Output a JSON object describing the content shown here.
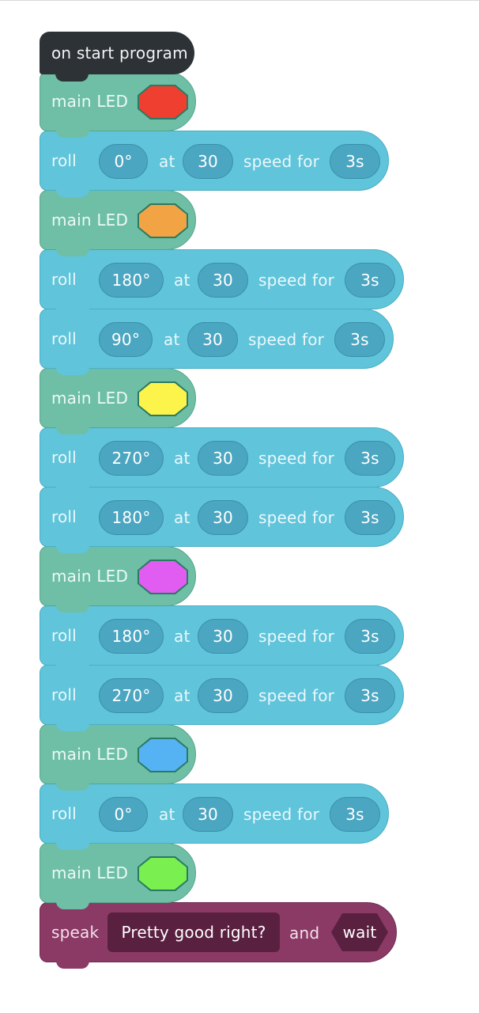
{
  "start": {
    "label": "on start program"
  },
  "blocks": [
    {
      "type": "led",
      "label": "main LED",
      "color": "#ee3f30"
    },
    {
      "type": "roll",
      "label": "roll",
      "heading": "0°",
      "at": "at",
      "speed": "30",
      "speed_for": "speed for",
      "duration": "3s"
    },
    {
      "type": "led",
      "label": "main LED",
      "color": "#f2a444"
    },
    {
      "type": "roll",
      "label": "roll",
      "heading": "180°",
      "at": "at",
      "speed": "30",
      "speed_for": "speed for",
      "duration": "3s"
    },
    {
      "type": "roll",
      "label": "roll",
      "heading": "90°",
      "at": "at",
      "speed": "30",
      "speed_for": "speed for",
      "duration": "3s"
    },
    {
      "type": "led",
      "label": "main LED",
      "color": "#fdf44b"
    },
    {
      "type": "roll",
      "label": "roll",
      "heading": "270°",
      "at": "at",
      "speed": "30",
      "speed_for": "speed for",
      "duration": "3s"
    },
    {
      "type": "roll",
      "label": "roll",
      "heading": "180°",
      "at": "at",
      "speed": "30",
      "speed_for": "speed for",
      "duration": "3s"
    },
    {
      "type": "led",
      "label": "main LED",
      "color": "#e15cf0"
    },
    {
      "type": "roll",
      "label": "roll",
      "heading": "180°",
      "at": "at",
      "speed": "30",
      "speed_for": "speed for",
      "duration": "3s"
    },
    {
      "type": "roll",
      "label": "roll",
      "heading": "270°",
      "at": "at",
      "speed": "30",
      "speed_for": "speed for",
      "duration": "3s"
    },
    {
      "type": "led",
      "label": "main LED",
      "color": "#55b3f4"
    },
    {
      "type": "roll",
      "label": "roll",
      "heading": "0°",
      "at": "at",
      "speed": "30",
      "speed_for": "speed for",
      "duration": "3s"
    },
    {
      "type": "led",
      "label": "main LED",
      "color": "#79f050"
    }
  ],
  "speak": {
    "label": "speak",
    "text": "Pretty good right?",
    "and": "and",
    "wait": "wait"
  }
}
